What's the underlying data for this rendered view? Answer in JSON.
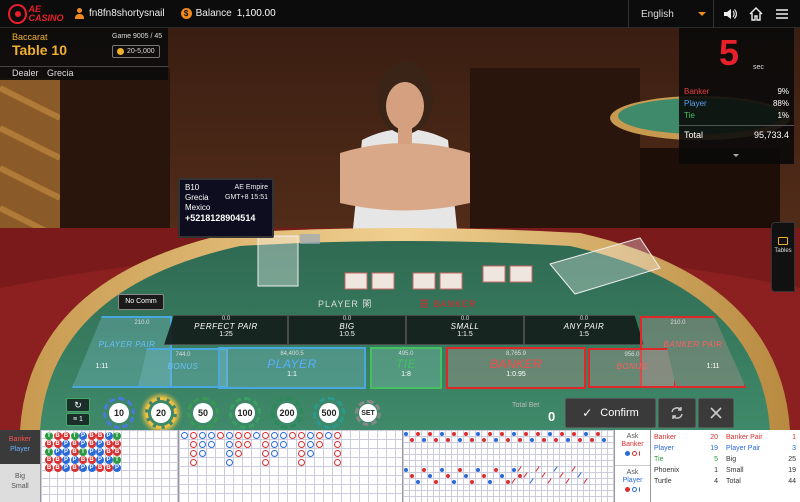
{
  "header": {
    "logo_text": "AE CASINO",
    "username": "fn8fn8shortysnail",
    "balance_label": "Balance",
    "balance_value": "1,100.00",
    "language": "English"
  },
  "table_info": {
    "game_type": "Baccarat",
    "table_name": "Table 10",
    "game_number": "Game 9005 / 45",
    "bet_limit": "20-5,000",
    "dealer_label": "Dealer",
    "dealer_name": "Grecia"
  },
  "monitor": {
    "table_code": "B10",
    "dealer": "Grecia",
    "country": "Mexico",
    "phone": "+5218128904514",
    "brand": "AE Empire",
    "time": "GMT+8 15:51"
  },
  "countdown": {
    "seconds": "5",
    "unit": "sec",
    "stats": [
      {
        "label": "Banker",
        "value": "9%",
        "color": "#e84040"
      },
      {
        "label": "Player",
        "value": "88%",
        "color": "#5aa0f0"
      },
      {
        "label": "Tie",
        "value": "1%",
        "color": "#46c060"
      }
    ],
    "total_label": "Total",
    "total_value": "95,733.4"
  },
  "side_tab": {
    "label": "Tables"
  },
  "board": {
    "no_comm": "No Comm",
    "player_side_label": "PLAYER 閑",
    "banker_side_label": "莊 BANKER",
    "bets": {
      "player_pair": {
        "amount": "210.0",
        "name": "PLAYER PAIR",
        "odds": "1:11"
      },
      "perfect_pair": {
        "amount": "0.0",
        "name": "PERFECT PAIR",
        "odds": "1:25"
      },
      "big": {
        "amount": "0.0",
        "name": "BIG",
        "odds": "1:0.5"
      },
      "small": {
        "amount": "0.0",
        "name": "SMALL",
        "odds": "1:1.5"
      },
      "any_pair": {
        "amount": "0.0",
        "name": "ANY PAIR",
        "odds": "1:5"
      },
      "banker_pair": {
        "amount": "210.0",
        "name": "BANKER PAIR",
        "odds": "1:11"
      },
      "player_bonus": {
        "amount": "744.0",
        "name": "BONUS"
      },
      "player": {
        "amount": "84,400.5",
        "name": "PLAYER",
        "odds": "1:1"
      },
      "tie": {
        "amount": "495.0",
        "name": "TIE",
        "odds": "1:8"
      },
      "banker": {
        "amount": "8,765.9",
        "name": "BANKER",
        "odds": "1:0.95"
      },
      "banker_bonus": {
        "amount": "956.0",
        "name": "BONUS"
      }
    }
  },
  "chips": [
    "10",
    "20",
    "50",
    "100",
    "200",
    "500",
    "SET"
  ],
  "selected_chip": "20",
  "chip_controls": {
    "top": "↻",
    "bottom": "≡ 1"
  },
  "controls": {
    "total_bet_label": "Total Bet",
    "total_bet_value": "0",
    "confirm": "Confirm"
  },
  "roadmap": {
    "legend_top": [
      "Banker",
      "Player"
    ],
    "legend_bottom": [
      "Big",
      "Small"
    ],
    "ask_banker": [
      "Ask",
      "Banker"
    ],
    "ask_player": [
      "Ask",
      "Player"
    ],
    "counts_left": [
      {
        "label": "Banker",
        "value": "20"
      },
      {
        "label": "Player",
        "value": "19"
      },
      {
        "label": "Tie",
        "value": "5"
      },
      {
        "label": "Phoenix",
        "value": "1"
      },
      {
        "label": "Turtle",
        "value": "4"
      }
    ],
    "counts_right": [
      {
        "label": "Banker Pair",
        "value": "1"
      },
      {
        "label": "Player Pair",
        "value": "3"
      },
      {
        "label": "Big",
        "value": "25"
      },
      {
        "label": "Small",
        "value": "19"
      },
      {
        "label": "Total",
        "value": "44"
      }
    ],
    "bead_plate": [
      [
        "T",
        "B",
        "B",
        "T",
        "P",
        "B",
        "B",
        "P",
        "T"
      ],
      [
        "B",
        "B",
        "P",
        "B",
        "P",
        "B",
        "P",
        "B",
        "B"
      ],
      [
        "T",
        "P",
        "P",
        "B",
        "T",
        "P",
        "P",
        "B",
        "B"
      ],
      [
        "B",
        "B",
        "P",
        "P",
        "B",
        "B",
        "P",
        "P",
        "T"
      ],
      [
        "B",
        "B",
        "P",
        "B",
        "P",
        "P",
        "B",
        "B",
        "P"
      ]
    ]
  }
}
